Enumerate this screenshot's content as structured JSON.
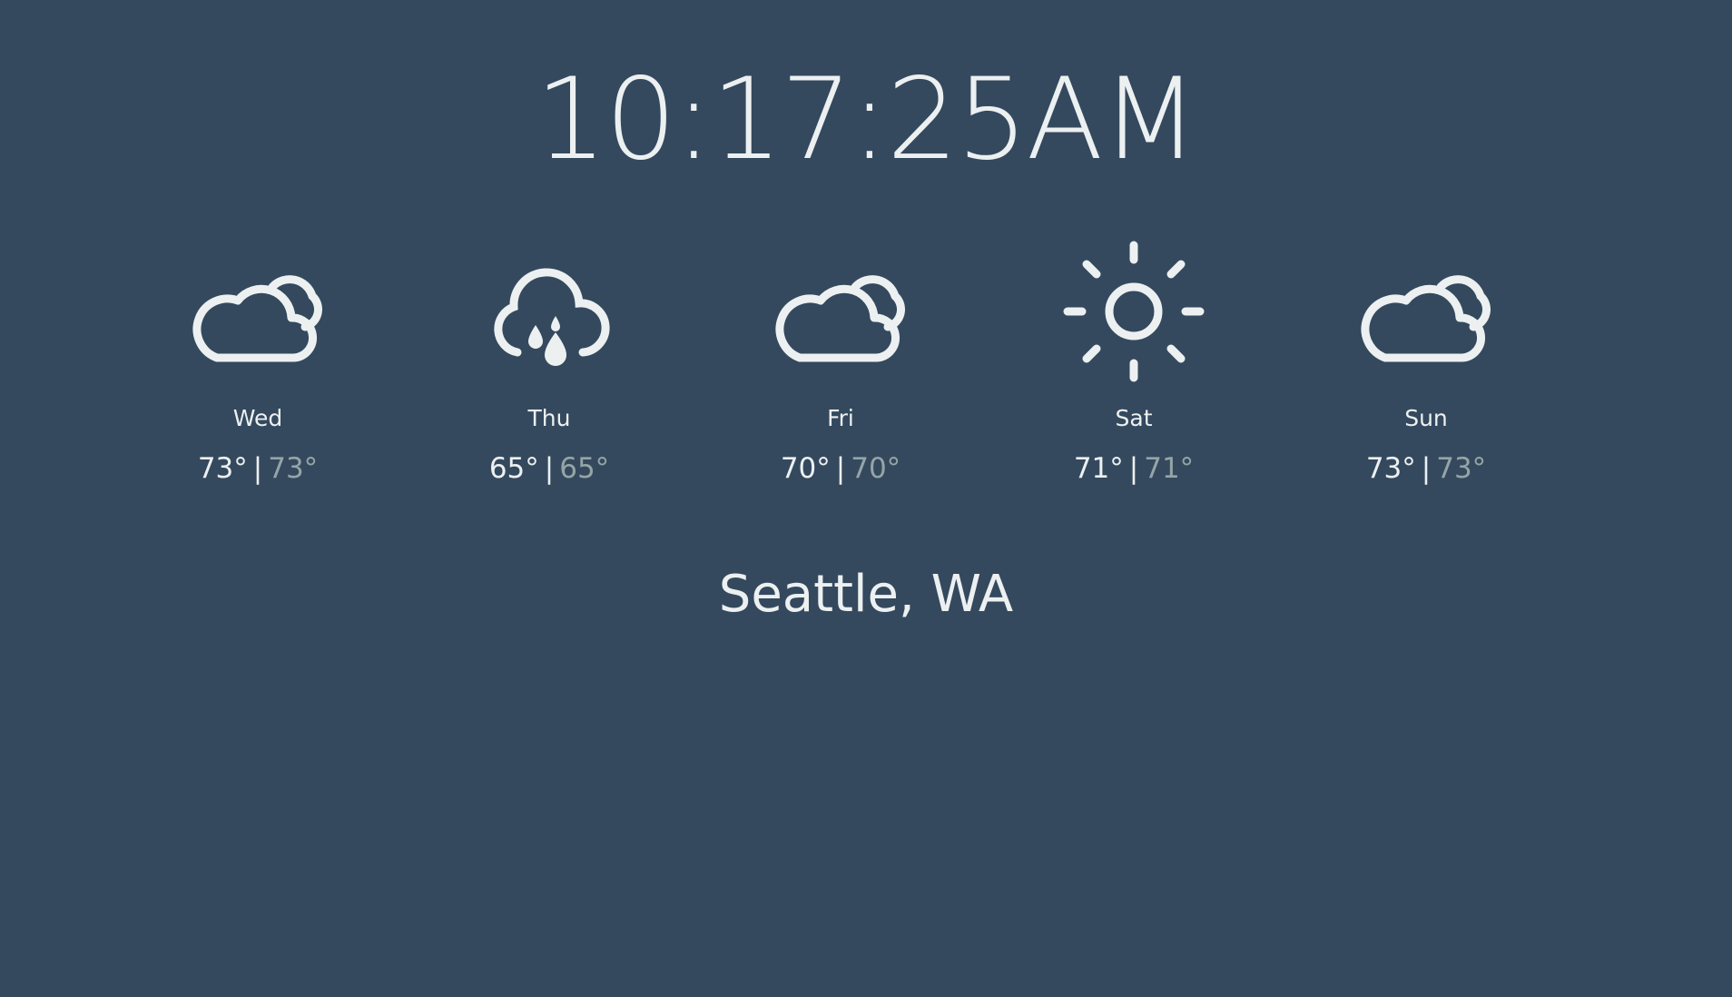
{
  "clock": {
    "time": "10:17:25AM"
  },
  "forecast": [
    {
      "day": "Wed",
      "high": "73°",
      "low": "73°",
      "icon": "cloudy-icon"
    },
    {
      "day": "Thu",
      "high": "65°",
      "low": "65°",
      "icon": "rain-icon"
    },
    {
      "day": "Fri",
      "high": "70°",
      "low": "70°",
      "icon": "cloudy-icon"
    },
    {
      "day": "Sat",
      "high": "71°",
      "low": "71°",
      "icon": "sun-icon"
    },
    {
      "day": "Sun",
      "high": "73°",
      "low": "73°",
      "icon": "cloudy-icon"
    }
  ],
  "separator": "|",
  "location": {
    "name": "Seattle, WA"
  },
  "colors": {
    "background": "#34495e",
    "foreground": "#ecf0f1",
    "muted": "#95a5a6"
  }
}
